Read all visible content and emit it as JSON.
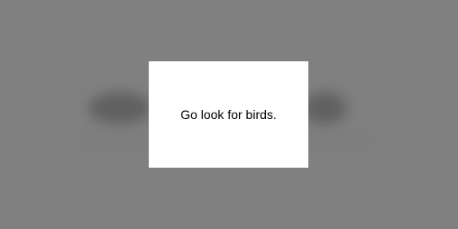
{
  "modal": {
    "message": "Go look for birds."
  },
  "colors": {
    "backdrop": "#808080",
    "modal_background": "#ffffff",
    "text": "#000000"
  }
}
